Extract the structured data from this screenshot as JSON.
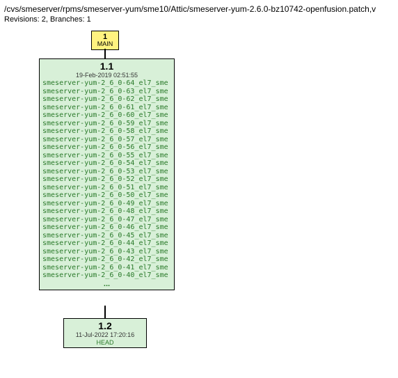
{
  "header": {
    "path": "/cvs/smeserver/rpms/smeserver-yum/sme10/Attic/smeserver-yum-2.6.0-bz10742-openfusion.patch,v",
    "revisions_label": "Revisions: 2, Branches: 1"
  },
  "branch": {
    "number": "1",
    "name": "MAIN"
  },
  "rev11": {
    "version": "1.1",
    "date": "19-Feb-2019 02:51:55",
    "tags": [
      "smeserver-yum-2_6_0-64_el7_sme",
      "smeserver-yum-2_6_0-63_el7_sme",
      "smeserver-yum-2_6_0-62_el7_sme",
      "smeserver-yum-2_6_0-61_el7_sme",
      "smeserver-yum-2_6_0-60_el7_sme",
      "smeserver-yum-2_6_0-59_el7_sme",
      "smeserver-yum-2_6_0-58_el7_sme",
      "smeserver-yum-2_6_0-57_el7_sme",
      "smeserver-yum-2_6_0-56_el7_sme",
      "smeserver-yum-2_6_0-55_el7_sme",
      "smeserver-yum-2_6_0-54_el7_sme",
      "smeserver-yum-2_6_0-53_el7_sme",
      "smeserver-yum-2_6_0-52_el7_sme",
      "smeserver-yum-2_6_0-51_el7_sme",
      "smeserver-yum-2_6_0-50_el7_sme",
      "smeserver-yum-2_6_0-49_el7_sme",
      "smeserver-yum-2_6_0-48_el7_sme",
      "smeserver-yum-2_6_0-47_el7_sme",
      "smeserver-yum-2_6_0-46_el7_sme",
      "smeserver-yum-2_6_0-45_el7_sme",
      "smeserver-yum-2_6_0-44_el7_sme",
      "smeserver-yum-2_6_0-43_el7_sme",
      "smeserver-yum-2_6_0-42_el7_sme",
      "smeserver-yum-2_6_0-41_el7_sme",
      "smeserver-yum-2_6_0-40_el7_sme"
    ],
    "ellipsis": "..."
  },
  "rev12": {
    "version": "1.2",
    "date": "11-Jul-2022 17:20:16",
    "head": "HEAD"
  }
}
